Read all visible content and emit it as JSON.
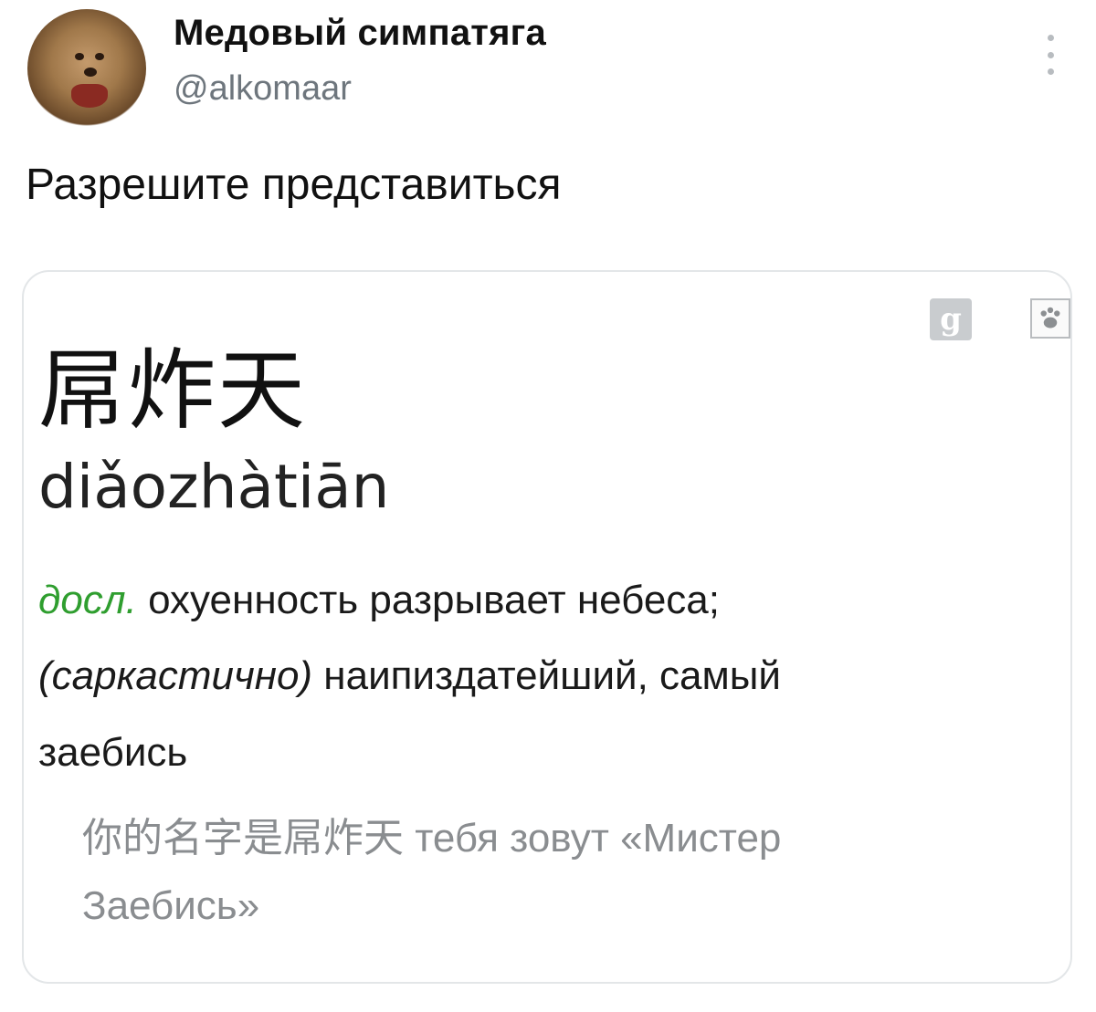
{
  "tweet": {
    "display_name": "Медовый симпатяга",
    "handle": "@alkomaar",
    "text": "Разрешите представиться"
  },
  "card": {
    "headword": "屌炸天",
    "pinyin": "diǎozhàtiān",
    "definition": {
      "tag": "досл.",
      "line1_rest": " охуенность разрывает небеса;",
      "line2_paren": "(саркастично)",
      "line2_rest": " наипиздатейший, самый",
      "line3": "заебись"
    },
    "example": {
      "chinese": "你的名字是屌炸天",
      "translation_part1": " тебя зовут «Мистер",
      "translation_part2": "Заебись»"
    },
    "icons": [
      "google-icon",
      "paw-icon"
    ]
  },
  "colors": {
    "tag_green": "#2f9e2f",
    "example_gray": "#8a8d90",
    "handle_gray": "#6e767d"
  }
}
